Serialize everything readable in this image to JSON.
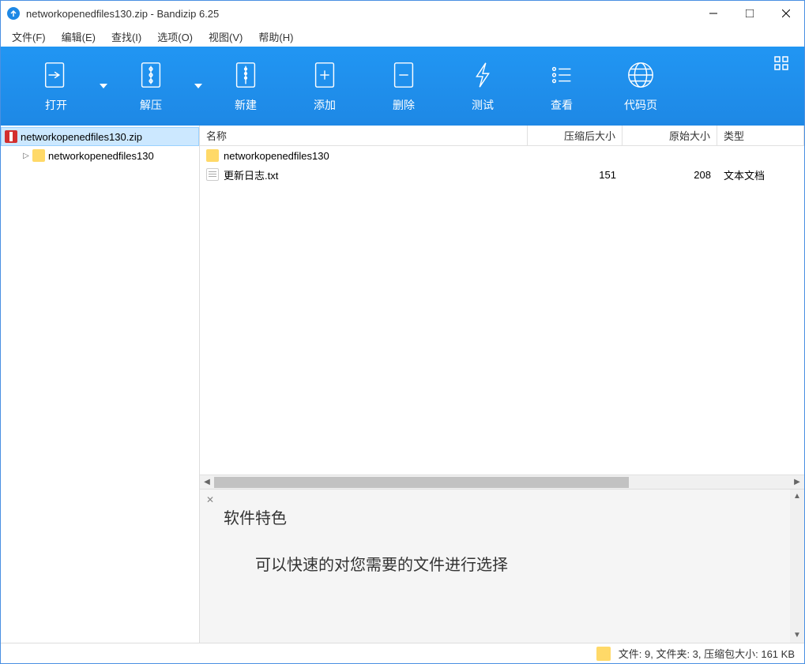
{
  "window": {
    "title": "networkopenedfiles130.zip - Bandizip 6.25"
  },
  "menu": {
    "file": "文件(F)",
    "edit": "编辑(E)",
    "find": "查找(I)",
    "options": "选项(O)",
    "view": "视图(V)",
    "help": "帮助(H)"
  },
  "toolbar": {
    "open": "打开",
    "extract": "解压",
    "new": "新建",
    "add": "添加",
    "delete": "删除",
    "test": "测试",
    "look": "查看",
    "codepage": "代码页"
  },
  "tree": {
    "root": "networkopenedfiles130.zip",
    "child": "networkopenedfiles130"
  },
  "columns": {
    "name": "名称",
    "compressed": "压缩后大小",
    "original": "原始大小",
    "type": "类型"
  },
  "files": [
    {
      "name": "networkopenedfiles130",
      "compressed": "",
      "original": "",
      "type": "",
      "kind": "folder"
    },
    {
      "name": "更新日志.txt",
      "compressed": "151",
      "original": "208",
      "type": "文本文档",
      "kind": "file"
    }
  ],
  "preview": {
    "title": "软件特色",
    "desc": "可以快速的对您需要的文件进行选择"
  },
  "status": {
    "text": "文件: 9, 文件夹: 3, 压缩包大小: 161 KB"
  }
}
